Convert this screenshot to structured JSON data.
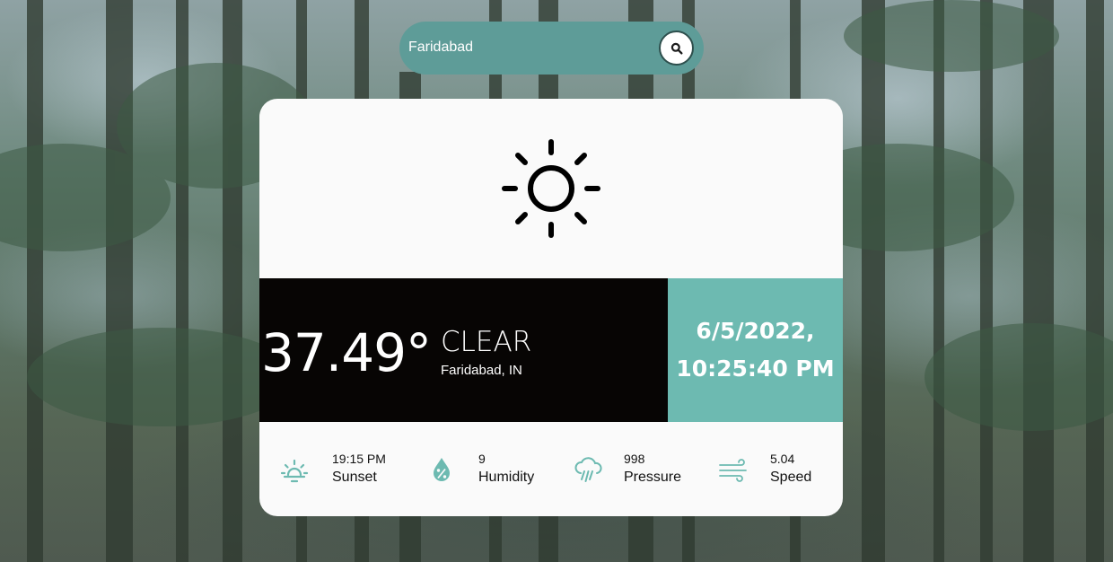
{
  "search": {
    "value": "Faridabad",
    "button_icon": "search-icon"
  },
  "weather": {
    "icon": "sun-icon",
    "temperature": "37.49°",
    "condition": "CLEAR",
    "location": "Faridabad, IN"
  },
  "datetime": {
    "date": "6/5/2022,",
    "time": "10:25:40 PM"
  },
  "stats": [
    {
      "icon": "sunset-icon",
      "value": "19:15 PM",
      "label": "Sunset"
    },
    {
      "icon": "humidity-icon",
      "value": "9",
      "label": "Humidity"
    },
    {
      "icon": "rain-cloud-icon",
      "value": "998",
      "label": "Pressure"
    },
    {
      "icon": "wind-icon",
      "value": "5.04",
      "label": "Speed"
    }
  ],
  "colors": {
    "search_bg": "#5e9c98",
    "card_bg": "#fafafa",
    "temp_panel_bg": "#070504",
    "date_panel_bg": "#6dbab1",
    "stat_icon": "#6dbab1"
  }
}
